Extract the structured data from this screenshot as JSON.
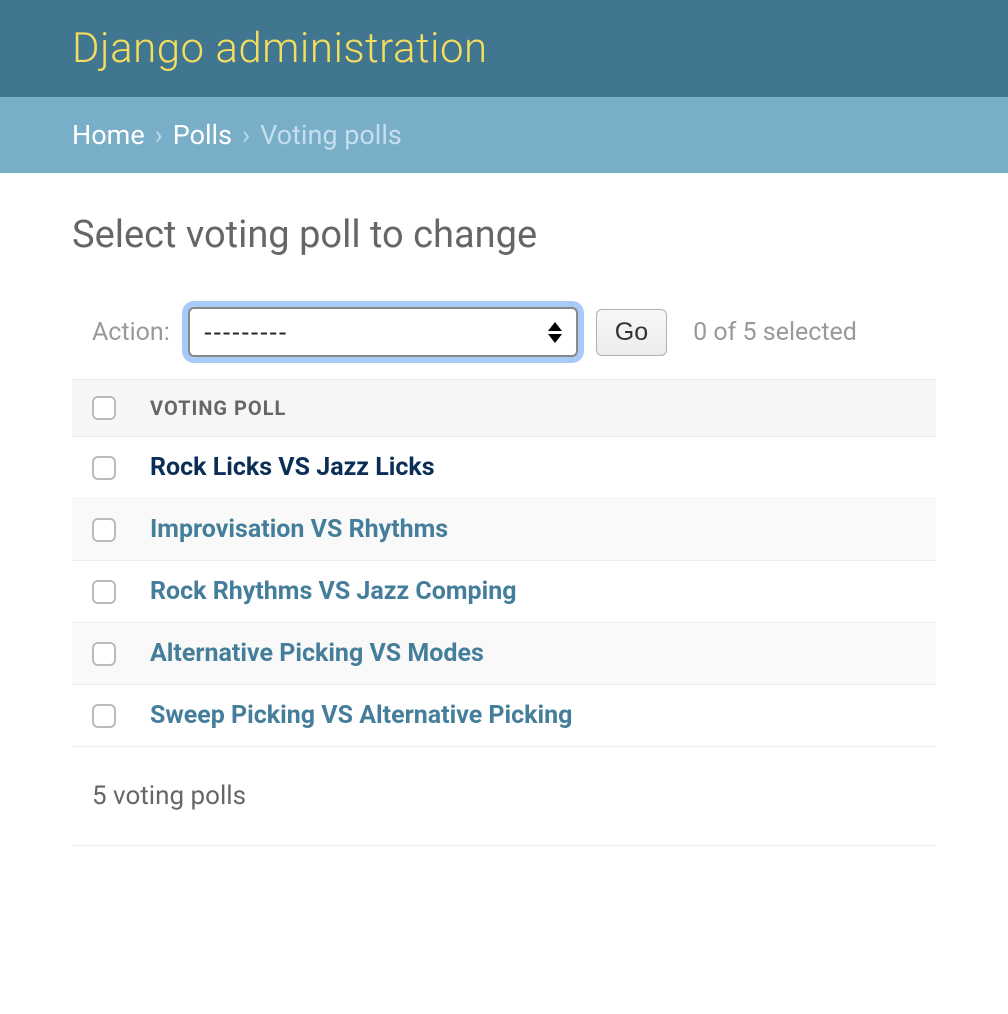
{
  "header": {
    "site_title": "Django administration"
  },
  "breadcrumbs": {
    "home": "Home",
    "sep": "›",
    "app": "Polls",
    "current": "Voting polls"
  },
  "page": {
    "title": "Select voting poll to change"
  },
  "actions": {
    "label": "Action:",
    "selected_option": "---------",
    "go_label": "Go",
    "selection_text": "0 of 5 selected"
  },
  "table": {
    "column_header": "VOTING POLL",
    "rows": [
      {
        "title": "Rock Licks VS Jazz Licks",
        "visited": true
      },
      {
        "title": "Improvisation VS Rhythms",
        "visited": false
      },
      {
        "title": "Rock Rhythms VS Jazz Comping",
        "visited": false
      },
      {
        "title": "Alternative Picking VS Modes",
        "visited": false
      },
      {
        "title": "Sweep Picking VS Alternative Picking",
        "visited": false
      }
    ],
    "footer": "5 voting polls"
  }
}
